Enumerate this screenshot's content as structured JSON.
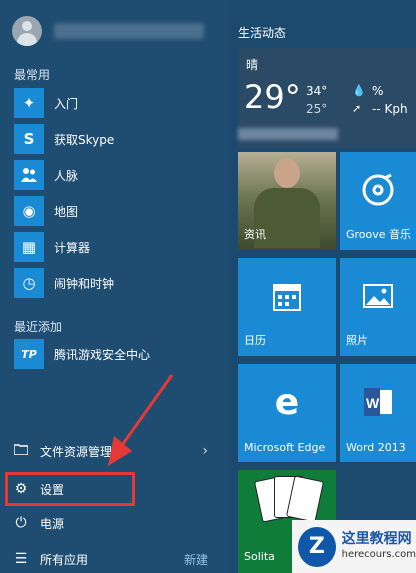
{
  "user": {
    "avatar_icon": "user-icon"
  },
  "left": {
    "most_used_label": "最常用",
    "most_used": [
      {
        "label": "入门",
        "icon": "lightbulb-icon",
        "glyph": "✦"
      },
      {
        "label": "获取Skype",
        "icon": "skype-icon",
        "glyph": "S"
      },
      {
        "label": "人脉",
        "icon": "people-icon",
        "glyph": "👥"
      },
      {
        "label": "地图",
        "icon": "maps-icon",
        "glyph": "◉"
      },
      {
        "label": "计算器",
        "icon": "calculator-icon",
        "glyph": "▦"
      },
      {
        "label": "闹钟和时钟",
        "icon": "alarm-clock-icon",
        "glyph": "◷"
      }
    ],
    "recent_label": "最近添加",
    "recent": [
      {
        "label": "腾讯游戏安全中心",
        "icon": "tp-icon",
        "glyph": "TP"
      }
    ],
    "system": {
      "file_explorer": "文件资源管理器",
      "settings": "设置",
      "power": "电源",
      "all_apps": "所有应用",
      "new_badge": "新建"
    }
  },
  "right": {
    "group_title": "生活动态",
    "weather": {
      "condition": "晴",
      "temp": "29°",
      "high": "34°",
      "low": "25°",
      "precip": "%",
      "wind": "-- Kph"
    },
    "tiles": {
      "news": "资讯",
      "groove": "Groove 音乐",
      "calendar": "日历",
      "photos": "照片",
      "edge": "Microsoft Edge",
      "word": "Word 2013",
      "solitaire": "Solita"
    }
  },
  "watermark": {
    "title": "这里教程网",
    "site": "herecours.com",
    "logo": "Z"
  },
  "colors": {
    "start_bg": "#1f4d72",
    "tile_blue": "#1a8ad4",
    "highlight_red": "#e53935"
  }
}
